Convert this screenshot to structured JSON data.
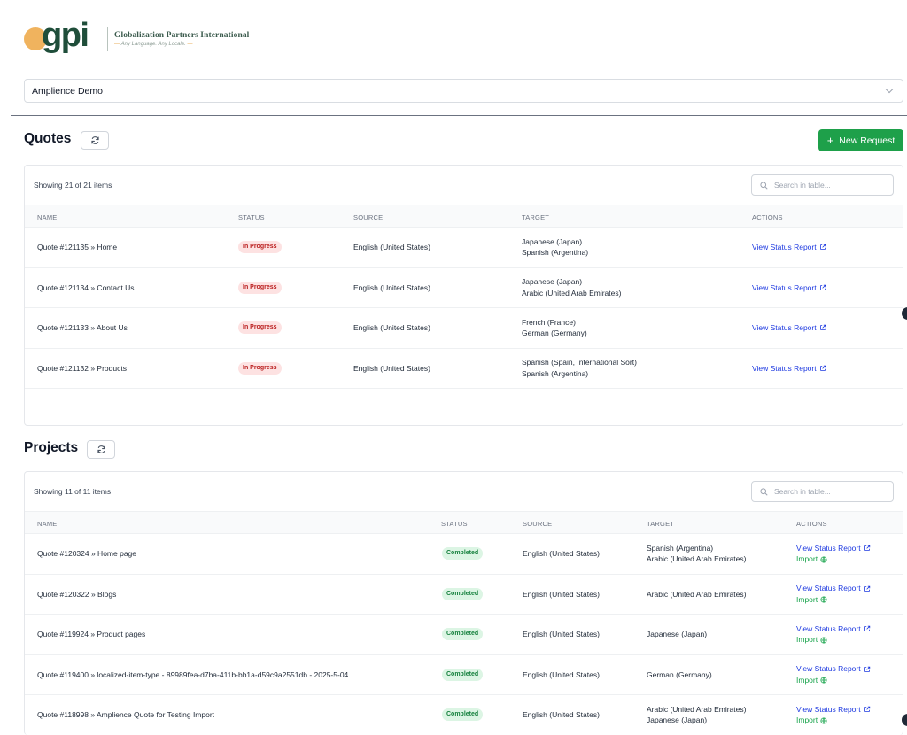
{
  "brand": {
    "logo_letters": "gpi",
    "company_name": "Globalization Partners International",
    "tagline": "Any Language. Any Locale."
  },
  "account_select": {
    "value": "Amplience Demo"
  },
  "quotes": {
    "title": "Quotes",
    "new_request_label": "New Request",
    "showing": "Showing 21 of 21 items",
    "search_placeholder": "Search in table...",
    "columns": [
      "NAME",
      "STATUS",
      "SOURCE",
      "TARGET",
      "ACTIONS"
    ],
    "rows": [
      {
        "name": "Quote #121135 » Home",
        "status": "In Progress",
        "source": "English (United States)",
        "target": [
          "Japanese (Japan)",
          "Spanish (Argentina)"
        ],
        "action": "View Status Report"
      },
      {
        "name": "Quote #121134 » Contact Us",
        "status": "In Progress",
        "source": "English (United States)",
        "target": [
          "Japanese (Japan)",
          "Arabic (United Arab Emirates)"
        ],
        "action": "View Status Report"
      },
      {
        "name": "Quote #121133 » About Us",
        "status": "In Progress",
        "source": "English (United States)",
        "target": [
          "French (France)",
          "German (Germany)"
        ],
        "action": "View Status Report"
      },
      {
        "name": "Quote #121132 » Products",
        "status": "In Progress",
        "source": "English (United States)",
        "target": [
          "Spanish (Spain, International Sort)",
          "Spanish (Argentina)"
        ],
        "action": "View Status Report"
      }
    ]
  },
  "projects": {
    "title": "Projects",
    "showing": "Showing 11 of 11 items",
    "search_placeholder": "Search in table...",
    "columns": [
      "NAME",
      "STATUS",
      "SOURCE",
      "TARGET",
      "ACTIONS"
    ],
    "rows": [
      {
        "name": "Quote #120324 » Home page",
        "status": "Completed",
        "source": "English (United States)",
        "target": [
          "Spanish (Argentina)",
          "Arabic (United Arab Emirates)"
        ],
        "action": "View Status Report",
        "import": "Import"
      },
      {
        "name": "Quote #120322 » Blogs",
        "status": "Completed",
        "source": "English (United States)",
        "target": [
          "Arabic (United Arab Emirates)"
        ],
        "action": "View Status Report",
        "import": "Import"
      },
      {
        "name": "Quote #119924 » Product pages",
        "status": "Completed",
        "source": "English (United States)",
        "target": [
          "Japanese (Japan)"
        ],
        "action": "View Status Report",
        "import": "Import"
      },
      {
        "name": "Quote #119400 » localized-item-type - 89989fea-d7ba-411b-bb1a-d59c9a2551db - 2025-5-04",
        "status": "Completed",
        "source": "English (United States)",
        "target": [
          "German (Germany)"
        ],
        "action": "View Status Report",
        "import": "Import"
      },
      {
        "name": "Quote #118998 » Amplience Quote for Testing Import",
        "status": "Completed",
        "source": "English (United States)",
        "target": [
          "Arabic (United Arab Emirates)",
          "Japanese (Japan)"
        ],
        "action": "View Status Report",
        "import": "Import"
      }
    ]
  },
  "colors": {
    "brand_green": "#1f4e3a",
    "brand_orange": "#f0b35e",
    "primary_button": "#1ea04a",
    "link_blue": "#1d39e0",
    "in_progress_bg": "#fde2e2",
    "in_progress_text": "#b91c1c",
    "completed_bg": "#dcf5e4",
    "completed_text": "#15803d"
  }
}
